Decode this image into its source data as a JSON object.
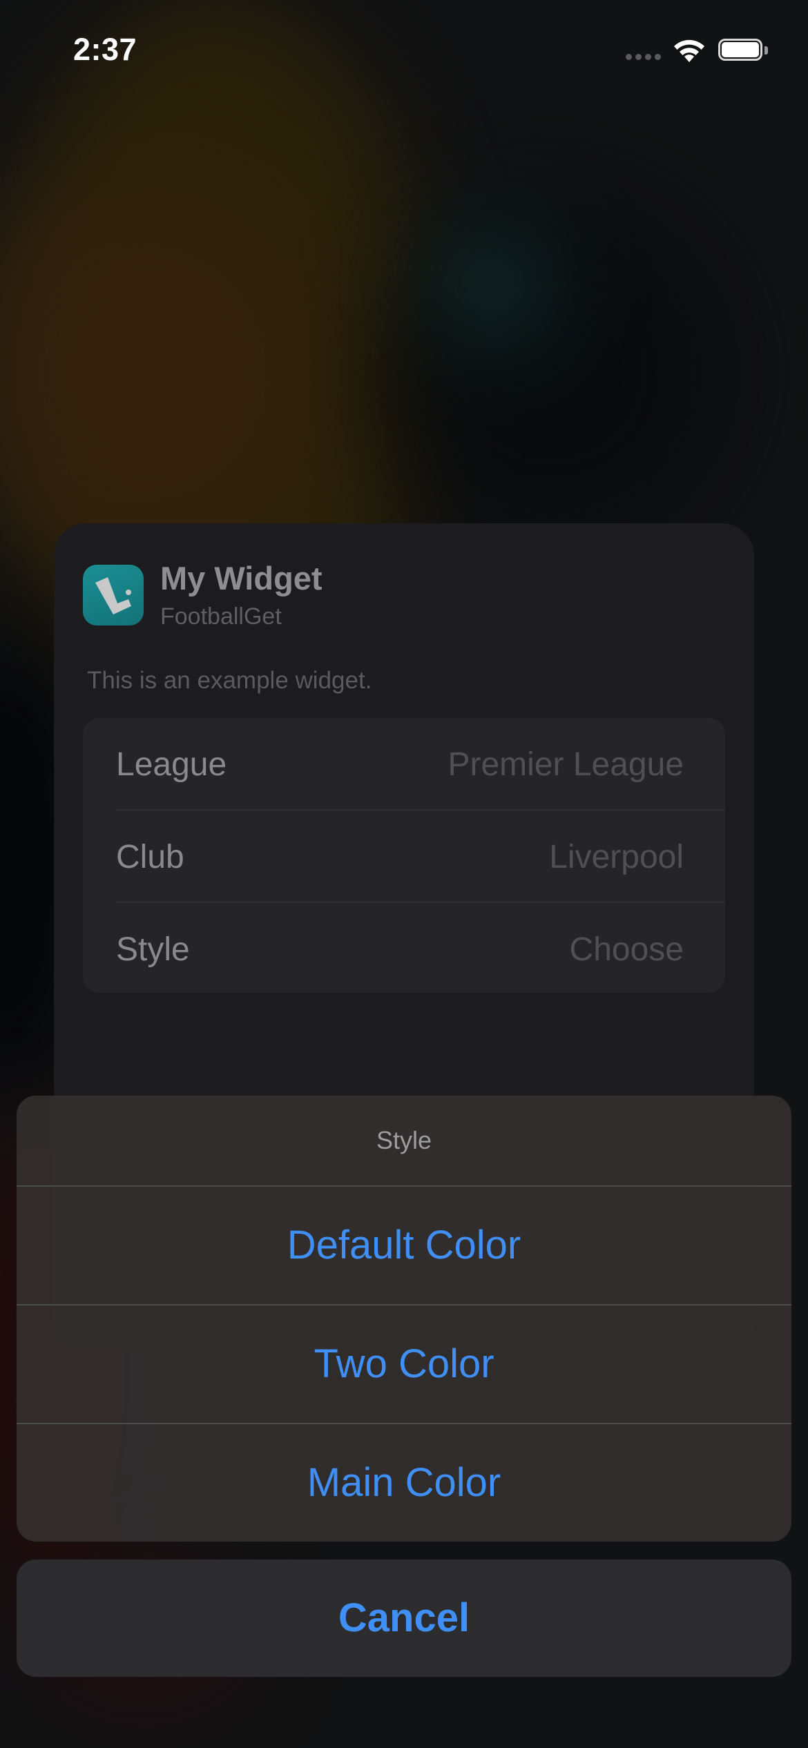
{
  "status_bar": {
    "time": "2:37"
  },
  "widget": {
    "title": "My Widget",
    "app_name": "FootballGet",
    "description": "This is an example widget.",
    "icon": "football-app-icon",
    "icon_color": "#1b8f94",
    "settings": [
      {
        "label": "League",
        "value": "Premier League"
      },
      {
        "label": "Club",
        "value": "Liverpool"
      },
      {
        "label": "Style",
        "value": "Choose"
      }
    ]
  },
  "action_sheet": {
    "title": "Style",
    "options": [
      {
        "label": "Default Color"
      },
      {
        "label": "Two Color"
      },
      {
        "label": "Main Color"
      }
    ],
    "cancel_label": "Cancel",
    "accent_color": "#3f8ff5"
  }
}
